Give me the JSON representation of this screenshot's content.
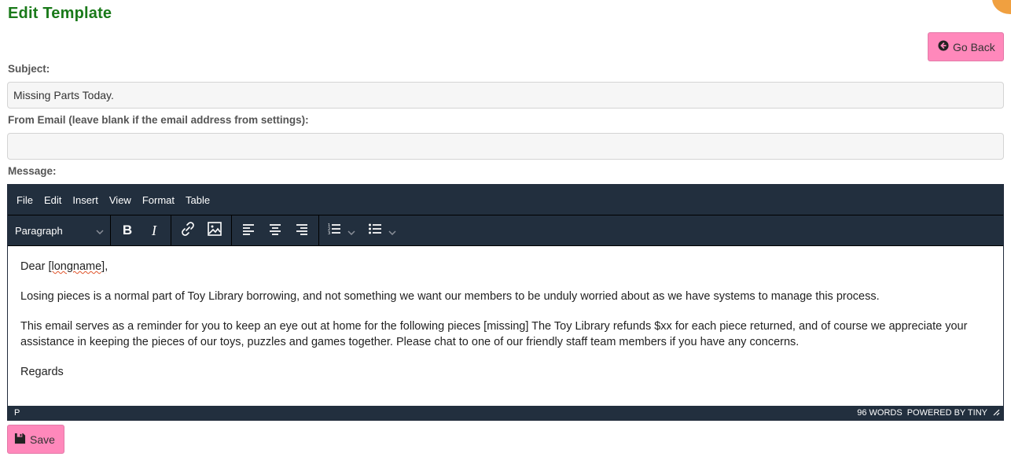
{
  "page": {
    "title": "Edit Template",
    "go_back_label": "Go Back",
    "save_label": "Save"
  },
  "form": {
    "subject_label": "Subject:",
    "subject_value": "Missing Parts Today.",
    "from_email_label": "From Email (leave blank if the email address from settings):",
    "from_email_value": "",
    "message_label": "Message:"
  },
  "editor": {
    "menu": [
      "File",
      "Edit",
      "Insert",
      "View",
      "Format",
      "Table"
    ],
    "block_format": "Paragraph",
    "toolbar_icons": [
      "bold-icon",
      "italic-icon",
      "link-icon",
      "image-icon",
      "align-left-icon",
      "align-center-icon",
      "align-right-icon",
      "numbered-list-icon",
      "bullet-list-icon"
    ],
    "content": {
      "greeting_prefix": "Dear ",
      "greeting_placeholder": "[longname]",
      "greeting_suffix": ",",
      "paragraph_1": "Losing pieces is a normal part of Toy Library borrowing, and not something we want our members to be unduly worried about as we have systems to manage this process.",
      "paragraph_2": "This email serves as a reminder for you to keep an eye out at home for the following pieces [missing] The Toy Library refunds $xx for each piece returned, and of course we appreciate your assistance in keeping the pieces of our toys, puzzles and games together. Please chat to one of our friendly staff team members if you have any concerns.",
      "closing": "Regards"
    },
    "status": {
      "path": "P",
      "word_count": "96 WORDS",
      "branding": "POWERED BY TINY"
    }
  },
  "colors": {
    "title_green": "#1a7a1a",
    "button_pink": "#ff88bb",
    "editor_dark": "#222f3e"
  }
}
